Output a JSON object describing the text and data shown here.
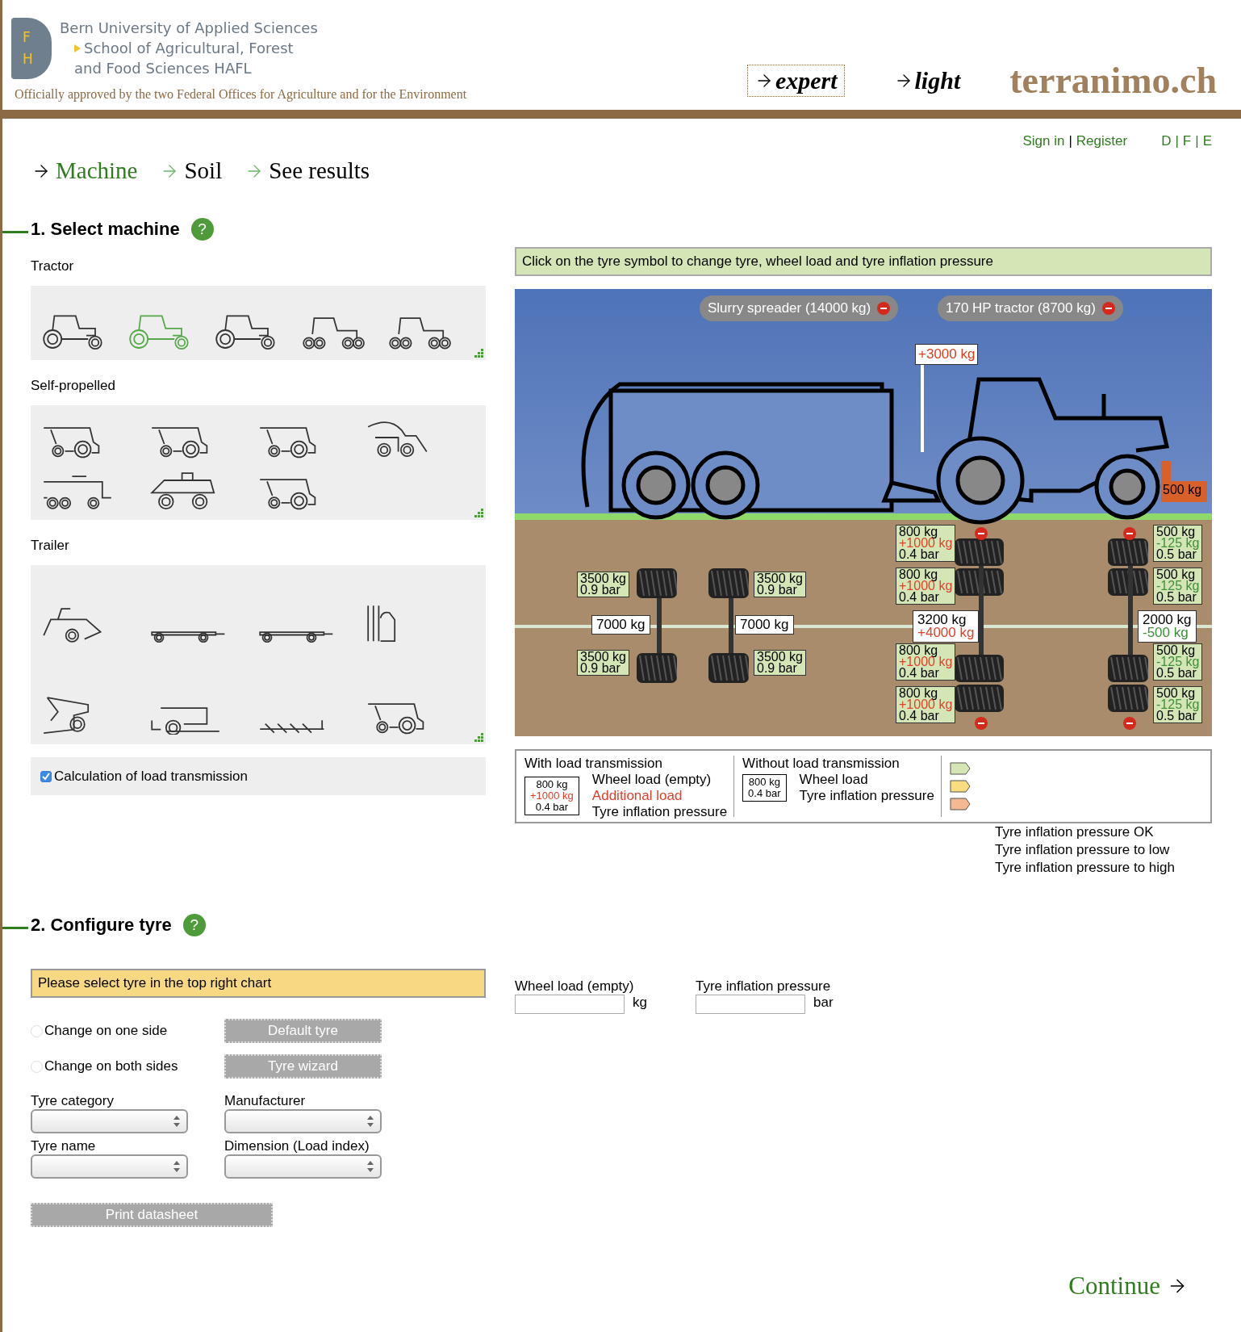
{
  "header": {
    "logo_letters": [
      "F",
      "H"
    ],
    "institution": [
      "Bern University of Applied Sciences",
      "School of Agricultural, Forest",
      "and Food Sciences HAFL"
    ],
    "approval": "Officially approved by the two Federal Offices for Agriculture and for the Environment",
    "modes": [
      {
        "label": "expert",
        "selected": true
      },
      {
        "label": "light",
        "selected": false
      }
    ],
    "brand": "terranimo.ch"
  },
  "account": {
    "links": [
      "Sign in",
      "Register"
    ],
    "separator": "|"
  },
  "languages": {
    "items": [
      "D",
      "F",
      "E"
    ],
    "separator": "|"
  },
  "steps": [
    {
      "label": "Machine",
      "selected": true
    },
    {
      "label": "Soil",
      "selected": false
    },
    {
      "label": "See results",
      "selected": false
    }
  ],
  "select_machine": {
    "title": "1. Select machine",
    "help": "?",
    "groups": [
      {
        "label": "Tractor",
        "items": [
          {
            "kind": "tractor",
            "selected": false
          },
          {
            "kind": "tractor",
            "selected": true
          },
          {
            "kind": "tractor",
            "selected": false
          },
          {
            "kind": "tracked",
            "selected": false
          },
          {
            "kind": "tracked",
            "selected": false
          }
        ]
      },
      {
        "label": "Self-propelled",
        "items": [
          {
            "kind": "harvester",
            "selected": false
          },
          {
            "kind": "harvester",
            "selected": false
          },
          {
            "kind": "harvester",
            "selected": false
          },
          {
            "kind": "forager",
            "selected": false
          },
          {
            "kind": "truck",
            "selected": false
          },
          {
            "kind": "sprayer",
            "selected": false
          },
          {
            "kind": "harvester",
            "selected": false
          }
        ]
      },
      {
        "label": "Trailer",
        "items": [
          {
            "kind": "baler",
            "selected": false
          },
          {
            "kind": "trailer",
            "selected": false
          },
          {
            "kind": "trailer",
            "selected": false
          },
          {
            "kind": "tank",
            "selected": false
          },
          {
            "kind": "spreader",
            "selected": false
          },
          {
            "kind": "wagon",
            "selected": false
          },
          {
            "kind": "plough",
            "selected": false
          },
          {
            "kind": "harvester",
            "selected": false
          }
        ]
      }
    ],
    "load_transmission": {
      "label": "Calculation of load transmission",
      "checked": true
    }
  },
  "diagram": {
    "hint": "Click on the tyre symbol to change tyre, wheel load and tyre inflation pressure",
    "machines": [
      {
        "label": "Slurry spreader (14000 kg)"
      },
      {
        "label": "170 HP tractor (8700 kg)"
      }
    ],
    "hitch_load": "+3000 kg",
    "ballast": "500 kg",
    "tyre_labels": [
      {
        "color": "#d4e6b5",
        "lines": [
          {
            "text": "3500 kg",
            "kind": "load"
          },
          {
            "text": "0.9 bar",
            "kind": "pressure"
          }
        ]
      },
      {
        "color": "#d4e6b5",
        "lines": [
          {
            "text": "3500 kg",
            "kind": "load"
          },
          {
            "text": "0.9 bar",
            "kind": "pressure"
          }
        ]
      },
      {
        "color": "#d4e6b5",
        "lines": [
          {
            "text": "3500 kg",
            "kind": "load"
          },
          {
            "text": "0.9 bar",
            "kind": "pressure"
          }
        ]
      },
      {
        "color": "#d4e6b5",
        "lines": [
          {
            "text": "3500 kg",
            "kind": "load"
          },
          {
            "text": "0.9 bar",
            "kind": "pressure"
          }
        ]
      },
      {
        "color": "#d4e6b5",
        "lines": [
          {
            "text": "800 kg",
            "kind": "load"
          },
          {
            "text": "+1000 kg",
            "kind": "add"
          },
          {
            "text": "0.4 bar",
            "kind": "pressure"
          }
        ]
      },
      {
        "color": "#d4e6b5",
        "lines": [
          {
            "text": "800 kg",
            "kind": "load"
          },
          {
            "text": "+1000 kg",
            "kind": "add"
          },
          {
            "text": "0.4 bar",
            "kind": "pressure"
          }
        ]
      },
      {
        "color": "#d4e6b5",
        "lines": [
          {
            "text": "800 kg",
            "kind": "load"
          },
          {
            "text": "+1000 kg",
            "kind": "add"
          },
          {
            "text": "0.4 bar",
            "kind": "pressure"
          }
        ]
      },
      {
        "color": "#d4e6b5",
        "lines": [
          {
            "text": "800 kg",
            "kind": "load"
          },
          {
            "text": "+1000 kg",
            "kind": "add"
          },
          {
            "text": "0.4 bar",
            "kind": "pressure"
          }
        ]
      },
      {
        "color": "#d4e6b5",
        "lines": [
          {
            "text": "500 kg",
            "kind": "load"
          },
          {
            "text": "-125 kg",
            "kind": "reduce"
          },
          {
            "text": "0.5 bar",
            "kind": "pressure"
          }
        ]
      },
      {
        "color": "#d4e6b5",
        "lines": [
          {
            "text": "500 kg",
            "kind": "load"
          },
          {
            "text": "-125 kg",
            "kind": "reduce"
          },
          {
            "text": "0.5 bar",
            "kind": "pressure"
          }
        ]
      },
      {
        "color": "#d4e6b5",
        "lines": [
          {
            "text": "500 kg",
            "kind": "load"
          },
          {
            "text": "-125 kg",
            "kind": "reduce"
          },
          {
            "text": "0.5 bar",
            "kind": "pressure"
          }
        ]
      },
      {
        "color": "#d4e6b5",
        "lines": [
          {
            "text": "500 kg",
            "kind": "load"
          },
          {
            "text": "-125 kg",
            "kind": "reduce"
          },
          {
            "text": "0.5 bar",
            "kind": "pressure"
          }
        ]
      }
    ],
    "axle_labels": [
      {
        "lines": [
          {
            "text": "7000 kg",
            "kind": "load"
          }
        ]
      },
      {
        "lines": [
          {
            "text": "7000 kg",
            "kind": "load"
          }
        ]
      },
      {
        "lines": [
          {
            "text": "3200 kg",
            "kind": "load"
          },
          {
            "text": "+4000 kg",
            "kind": "add"
          }
        ]
      },
      {
        "lines": [
          {
            "text": "2000 kg",
            "kind": "load"
          },
          {
            "text": "-500 kg",
            "kind": "reduce"
          }
        ]
      }
    ]
  },
  "legend": {
    "groups": [
      {
        "title": "With load transmission",
        "sample": [
          {
            "text": "800 kg",
            "kind": "load"
          },
          {
            "text": "+1000 kg",
            "kind": "add"
          },
          {
            "text": "0.4 bar",
            "kind": "pressure"
          }
        ],
        "descriptions": [
          {
            "text": "Wheel load (empty)",
            "kind": "load"
          },
          {
            "text": "Additional load",
            "kind": "add"
          },
          {
            "text": "Tyre inflation pressure",
            "kind": "pressure"
          }
        ]
      },
      {
        "title": "Without load transmission",
        "sample": [
          {
            "text": "800 kg",
            "kind": "load"
          },
          {
            "text": "0.4 bar",
            "kind": "pressure"
          }
        ],
        "descriptions": [
          {
            "text": "Wheel load",
            "kind": "load"
          },
          {
            "text": "Tyre inflation pressure",
            "kind": "pressure"
          }
        ]
      }
    ],
    "statuses": [
      {
        "label": "Tyre inflation pressure OK",
        "color": "#d4e6b5"
      },
      {
        "label": "Tyre inflation pressure to low",
        "color": "#f8dc7e"
      },
      {
        "label": "Tyre inflation pressure to high",
        "color": "#f4b892"
      }
    ]
  },
  "configure_tyre": {
    "title": "2. Configure tyre",
    "help": "?",
    "notice": "Please select tyre in the top right chart",
    "options": [
      {
        "label": "Change on one side",
        "selected": false
      },
      {
        "label": "Change on both sides",
        "selected": false
      }
    ],
    "buttons": [
      "Default tyre",
      "Tyre wizard"
    ],
    "selects": [
      {
        "label": "Tyre category"
      },
      {
        "label": "Manufacturer"
      },
      {
        "label": "Tyre name"
      },
      {
        "label": "Dimension (Load index)"
      }
    ],
    "print": "Print datasheet",
    "fields": [
      {
        "label": "Wheel load (empty)",
        "unit": "kg"
      },
      {
        "label": "Tyre inflation pressure",
        "unit": "bar"
      }
    ]
  },
  "continue": "Continue"
}
